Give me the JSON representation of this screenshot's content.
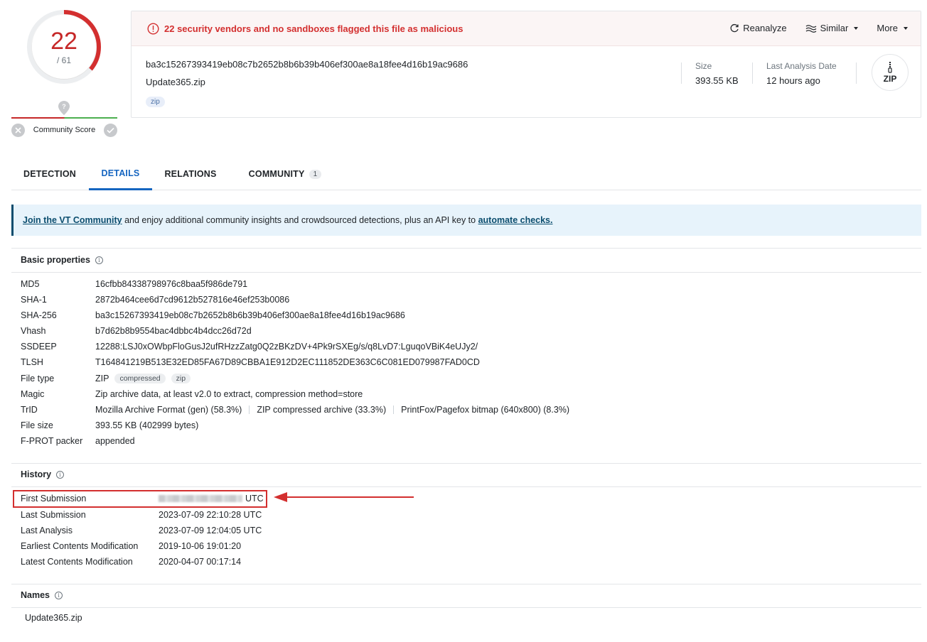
{
  "score": {
    "detections": "22",
    "total": "/ 61",
    "ratio": 0.3607
  },
  "community": {
    "label": "Community Score"
  },
  "header": {
    "alert": "22 security vendors and no sandboxes flagged this file as malicious",
    "actions": {
      "reanalyze": "Reanalyze",
      "similar": "Similar",
      "more": "More"
    },
    "hash": "ba3c15267393419eb08c7b2652b8b6b39b406ef300ae8a18fee4d16b19ac9686",
    "filename": "Update365.zip",
    "tag": "zip",
    "size_label": "Size",
    "size_value": "393.55 KB",
    "date_label": "Last Analysis Date",
    "date_value": "12 hours ago",
    "filetype_badge": "ZIP"
  },
  "tabs": [
    {
      "label": "DETECTION"
    },
    {
      "label": "DETAILS"
    },
    {
      "label": "RELATIONS"
    },
    {
      "label": "COMMUNITY",
      "count": "1"
    }
  ],
  "banner": {
    "link1": "Join the VT Community",
    "text": " and enjoy additional community insights and crowdsourced detections, plus an API key to ",
    "link2": "automate checks."
  },
  "basic": {
    "title": "Basic properties",
    "rows": [
      {
        "key": "MD5",
        "value": "16cfbb84338798976c8baa5f986de791"
      },
      {
        "key": "SHA-1",
        "value": "2872b464cee6d7cd9612b527816e46ef253b0086"
      },
      {
        "key": "SHA-256",
        "value": "ba3c15267393419eb08c7b2652b8b6b39b406ef300ae8a18fee4d16b19ac9686"
      },
      {
        "key": "Vhash",
        "value": "b7d62b8b9554bac4dbbc4b4dcc26d72d"
      },
      {
        "key": "SSDEEP",
        "value": "12288:LSJ0xOWbpFloGusJ2ufRHzzZatg0Q2zBKzDV+4Pk9rSXEg/s/q8LvD7:LguqoVBiK4eUJy2/"
      },
      {
        "key": "TLSH",
        "value": "T164841219B513E32ED85FA67D89CBBA1E912D2EC111852DE363C6C081ED079987FAD0CD"
      }
    ],
    "filetype": {
      "key": "File type",
      "value": "ZIP",
      "tags": [
        "compressed",
        "zip"
      ]
    },
    "magic": {
      "key": "Magic",
      "value": "Zip archive data, at least v2.0 to extract, compression method=store"
    },
    "trid": {
      "key": "TrID",
      "values": [
        "Mozilla Archive Format (gen) (58.3%)",
        "ZIP compressed archive (33.3%)",
        "PrintFox/Pagefox bitmap (640x800) (8.3%)"
      ]
    },
    "filesize": {
      "key": "File size",
      "value": "393.55 KB (402999 bytes)"
    },
    "fprot": {
      "key": "F-PROT packer",
      "value": "appended"
    }
  },
  "history": {
    "title": "History",
    "first": {
      "key": "First Submission",
      "suffix": "UTC"
    },
    "rows": [
      {
        "key": "Last Submission",
        "value": "2023-07-09 22:10:28 UTC"
      },
      {
        "key": "Last Analysis",
        "value": "2023-07-09 12:04:05 UTC"
      },
      {
        "key": "Earliest Contents Modification",
        "value": "2019-10-06 19:01:20"
      },
      {
        "key": "Latest Contents Modification",
        "value": "2020-04-07 00:17:14"
      }
    ]
  },
  "names": {
    "title": "Names",
    "items": [
      "Update365.zip"
    ]
  },
  "colors": {
    "malicious": "#d32f2f",
    "accent": "#1565c0",
    "banner": "#e7f3fb"
  }
}
